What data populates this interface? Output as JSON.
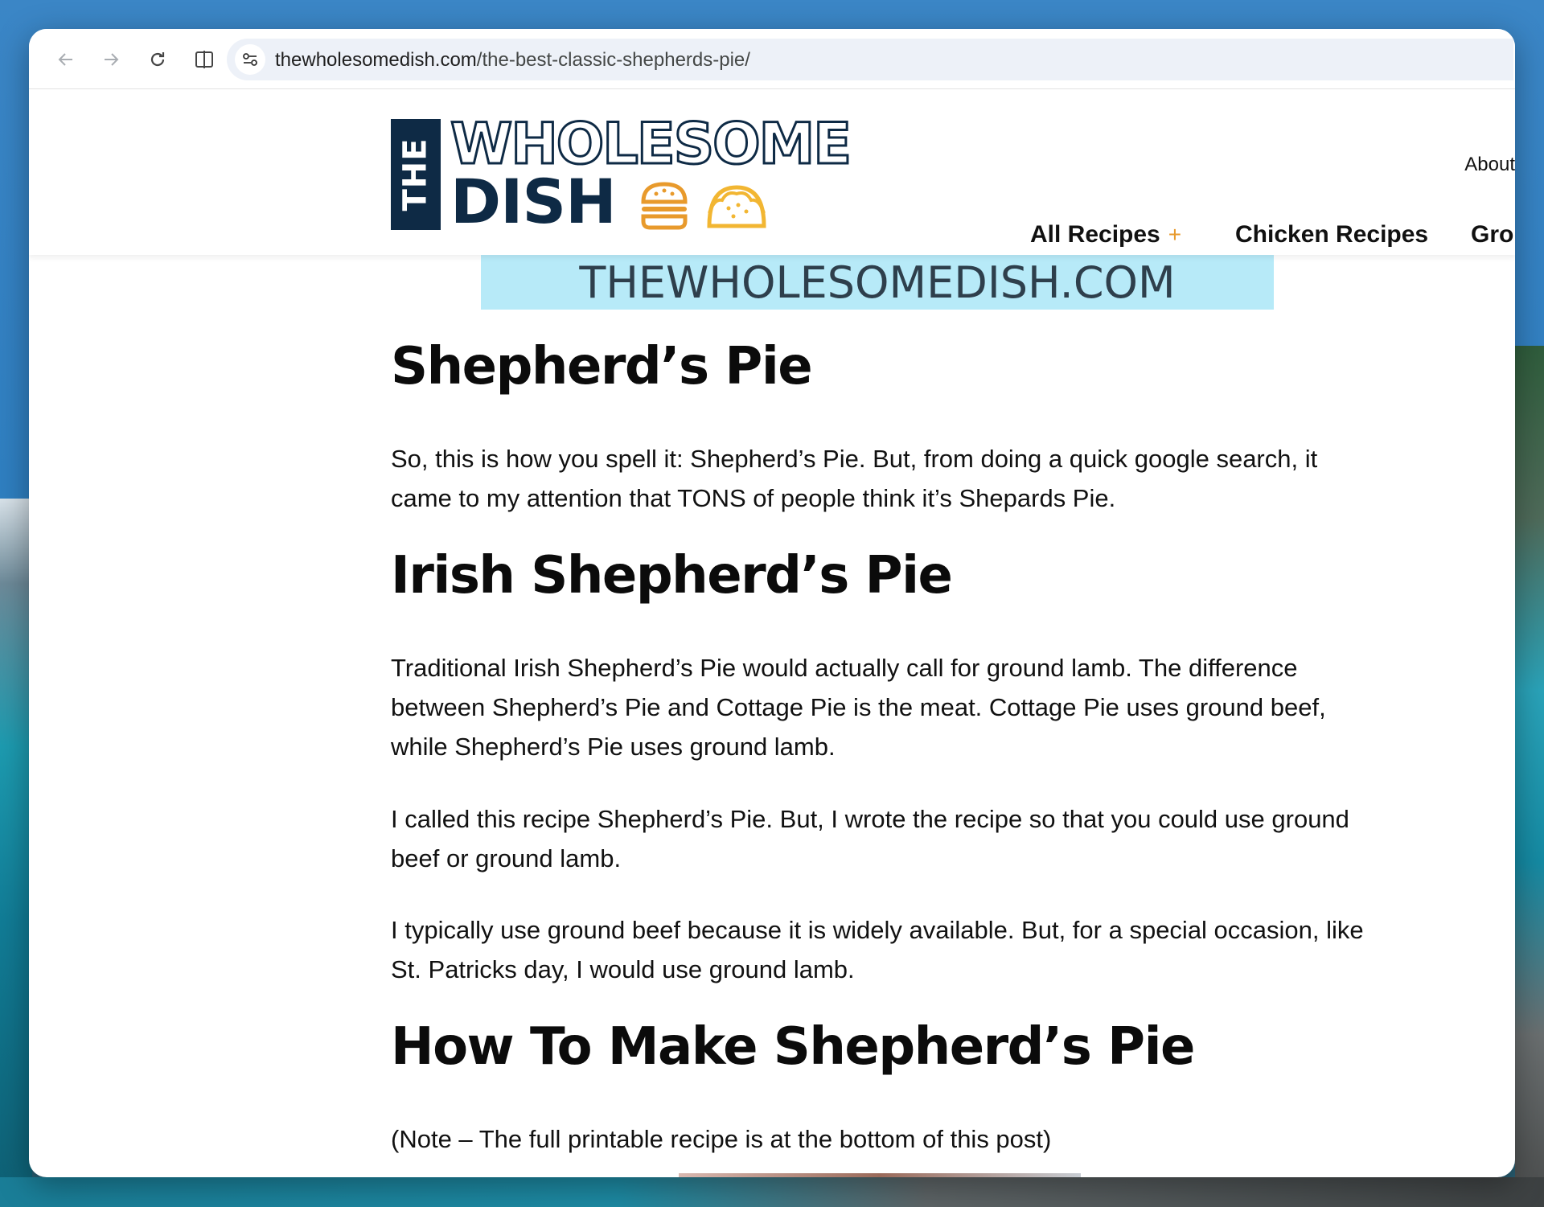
{
  "browser": {
    "back_icon": "arrow-left-icon",
    "forward_icon": "arrow-right-icon",
    "reload_icon": "reload-icon",
    "split_icon": "split-view-icon",
    "site_info_icon": "tune-icon",
    "url_host": "thewholesomedish.com",
    "url_path": "/the-best-classic-shepherds-pie/"
  },
  "header": {
    "logo": {
      "the": "THE",
      "word1": "WHOLESOME",
      "word2": "DISH",
      "burger_icon": "burger-icon",
      "taco_icon": "taco-icon"
    },
    "about_link": "About",
    "nav": [
      {
        "label": "All Recipes",
        "has_submenu": true,
        "submenu_symbol": "+"
      },
      {
        "label": "Chicken Recipes"
      },
      {
        "label": "Groun"
      }
    ]
  },
  "ad_banner": {
    "text": "THEWHOLESOMEDISH.COM"
  },
  "article": {
    "heading_1": "Shepherd’s Pie",
    "paragraph_1": "So, this is how you spell it:  Shepherd’s Pie.  But, from doing a quick google search, it came to my attention that TONS of people think it’s Shepards Pie.",
    "heading_2": "Irish Shepherd’s Pie",
    "paragraph_2": "Traditional Irish Shepherd’s Pie would actually call for ground lamb.  The difference between Shepherd’s Pie and Cottage Pie is the meat.  Cottage Pie uses ground beef, while Shepherd’s Pie uses ground lamb.",
    "paragraph_3": "I called this recipe Shepherd’s Pie.  But, I wrote the recipe so that you could use ground beef or ground lamb.",
    "paragraph_4": "I typically use ground beef because it is widely available.  But, for a special occasion, like St. Patricks day, I would use ground lamb.",
    "heading_3": "How To Make Shepherd’s Pie",
    "paragraph_5": "(Note – The full printable recipe is at the bottom of this post)"
  },
  "colors": {
    "brand_navy": "#0e2a45",
    "brand_orange": "#e89a2c",
    "taco_yellow": "#f2b632",
    "banner_bg": "#b7eaf8"
  }
}
